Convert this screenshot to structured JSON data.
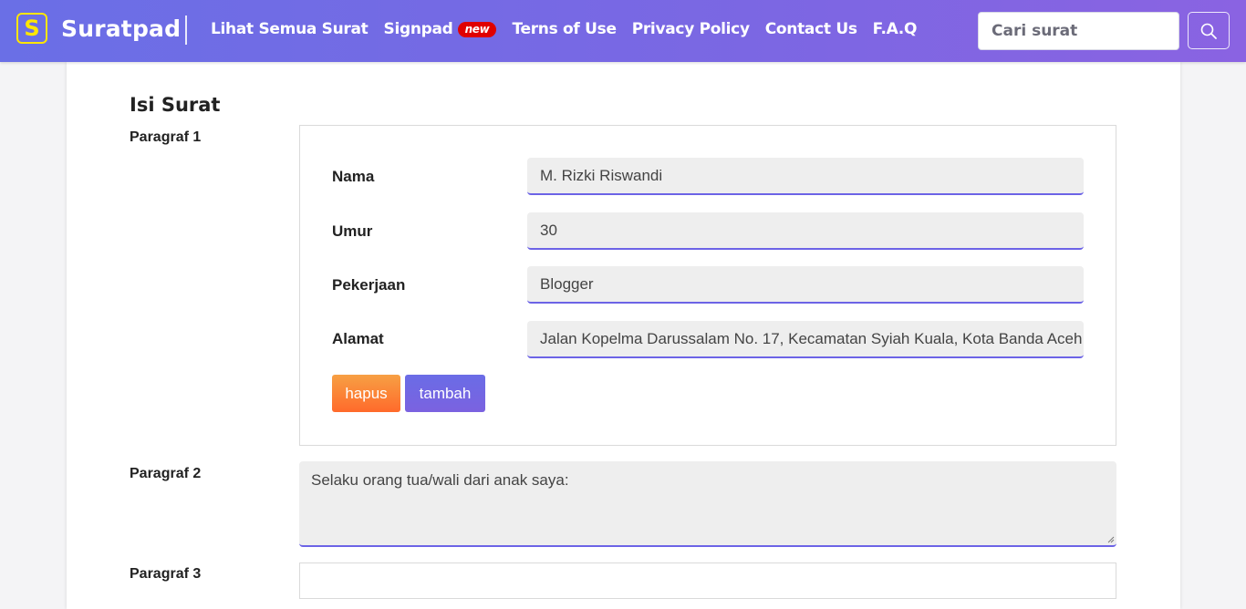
{
  "navbar": {
    "brand_logo_letter": "S",
    "brand_name": "Suratpad",
    "links": [
      "Lihat Semua Surat",
      "Signpad",
      "Terns of Use",
      "Privacy Policy",
      "Contact Us",
      "F.A.Q"
    ],
    "new_badge": "new",
    "search_placeholder": "Cari surat",
    "search_icon": "search-icon",
    "logo_color": "#ffe600",
    "accent": "#6c63e6"
  },
  "content": {
    "section_title": "Isi Surat",
    "paragraf1": {
      "label": "Paragraf 1",
      "fields": [
        {
          "label": "Nama",
          "value": "M. Rizki Riswandi"
        },
        {
          "label": "Umur",
          "value": "30"
        },
        {
          "label": "Pekerjaan",
          "value": "Blogger"
        },
        {
          "label": "Alamat",
          "value": "Jalan Kopelma Darussalam No. 17, Kecamatan Syiah Kuala, Kota Banda Aceh"
        }
      ],
      "delete_label": "hapus",
      "add_label": "tambah"
    },
    "paragraf2": {
      "label": "Paragraf 2",
      "text": "Selaku orang tua/wali dari anak saya:"
    },
    "paragraf3": {
      "label": "Paragraf 3"
    }
  }
}
